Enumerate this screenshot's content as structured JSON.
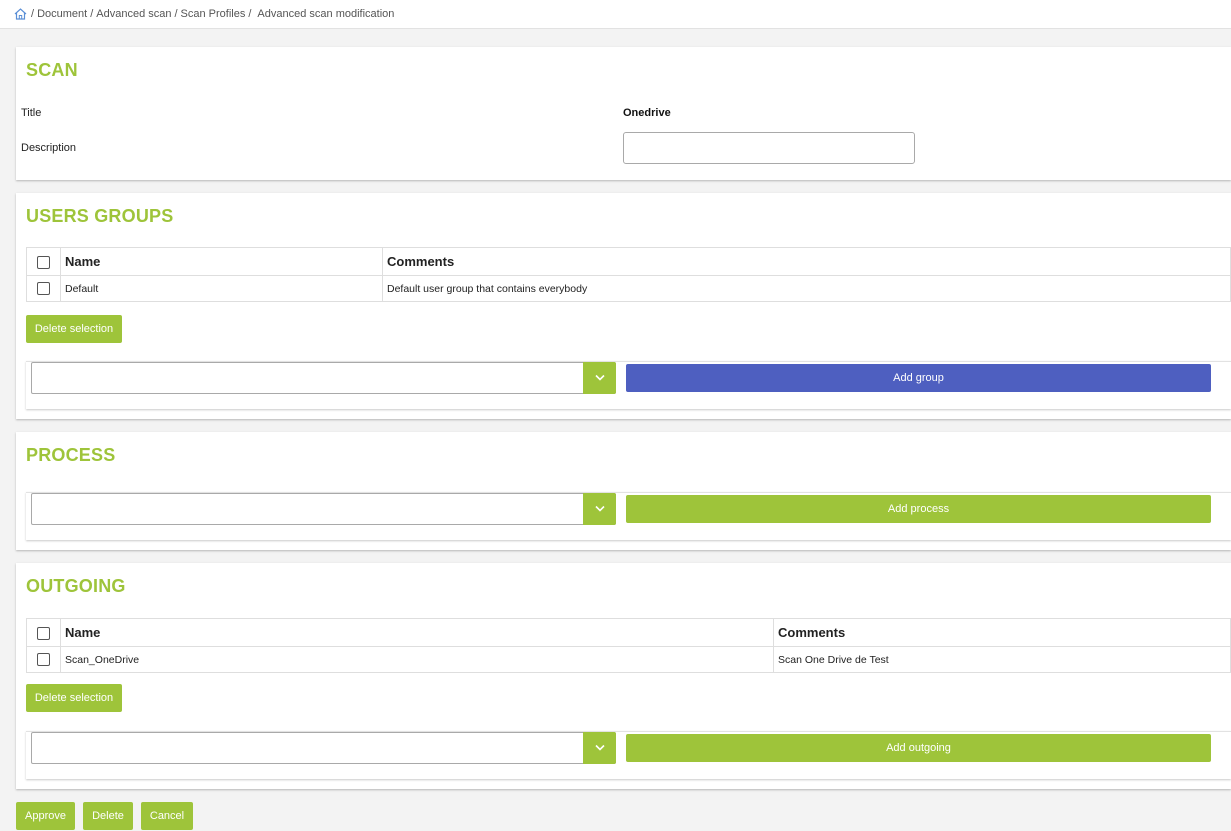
{
  "breadcrumb": {
    "items": [
      "Document",
      "Advanced scan",
      "Scan Profiles",
      "Advanced scan modification"
    ]
  },
  "scan": {
    "heading": "SCAN",
    "title_label": "Title",
    "title_value": "Onedrive",
    "description_label": "Description",
    "description_value": ""
  },
  "users_groups": {
    "heading": "USERS GROUPS",
    "columns": [
      "Name",
      "Comments"
    ],
    "rows": [
      {
        "name": "Default",
        "comment": "Default user group that contains everybody"
      }
    ],
    "delete_label": "Delete selection",
    "select_value": "",
    "add_label": "Add group"
  },
  "process": {
    "heading": "PROCESS",
    "select_value": "",
    "add_label": "Add process"
  },
  "outgoing": {
    "heading": "OUTGOING",
    "columns": [
      "Name",
      "Comments"
    ],
    "rows": [
      {
        "name": "Scan_OneDrive",
        "comment": "Scan One Drive de Test"
      }
    ],
    "delete_label": "Delete selection",
    "select_value": "",
    "add_label": "Add outgoing"
  },
  "footer": {
    "approve_label": "Approve",
    "delete_label": "Delete",
    "cancel_label": "Cancel"
  },
  "colors": {
    "accent_green": "#9ec43a",
    "add_group_blue": "#4e5fc0"
  }
}
